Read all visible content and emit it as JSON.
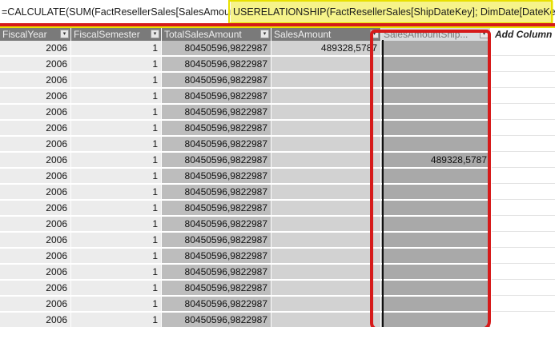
{
  "formula": {
    "part1": "=CALCULATE(SUM(FactResellerSales[SalesAmount]);",
    "part2": "USERELATIONSHIP(FactResellerSales[ShipDateKey]; DimDate[DateKey]))"
  },
  "headers": [
    "FiscalYear",
    "FiscalSemester",
    "TotalSalesAmount",
    "SalesAmount",
    "SalesAmountShip..."
  ],
  "add_column": "Add Column",
  "rows": [
    {
      "year": "2006",
      "semester": "1",
      "total": "80450596,9822987",
      "sales": "489328,5787",
      "ship": ""
    },
    {
      "year": "2006",
      "semester": "1",
      "total": "80450596,9822987",
      "sales": "",
      "ship": ""
    },
    {
      "year": "2006",
      "semester": "1",
      "total": "80450596,9822987",
      "sales": "",
      "ship": ""
    },
    {
      "year": "2006",
      "semester": "1",
      "total": "80450596,9822987",
      "sales": "",
      "ship": ""
    },
    {
      "year": "2006",
      "semester": "1",
      "total": "80450596,9822987",
      "sales": "",
      "ship": ""
    },
    {
      "year": "2006",
      "semester": "1",
      "total": "80450596,9822987",
      "sales": "",
      "ship": ""
    },
    {
      "year": "2006",
      "semester": "1",
      "total": "80450596,9822987",
      "sales": "",
      "ship": ""
    },
    {
      "year": "2006",
      "semester": "1",
      "total": "80450596,9822987",
      "sales": "",
      "ship": "489328,5787"
    },
    {
      "year": "2006",
      "semester": "1",
      "total": "80450596,9822987",
      "sales": "",
      "ship": ""
    },
    {
      "year": "2006",
      "semester": "1",
      "total": "80450596,9822987",
      "sales": "",
      "ship": ""
    },
    {
      "year": "2006",
      "semester": "1",
      "total": "80450596,9822987",
      "sales": "",
      "ship": ""
    },
    {
      "year": "2006",
      "semester": "1",
      "total": "80450596,9822987",
      "sales": "",
      "ship": ""
    },
    {
      "year": "2006",
      "semester": "1",
      "total": "80450596,9822987",
      "sales": "",
      "ship": ""
    },
    {
      "year": "2006",
      "semester": "1",
      "total": "80450596,9822987",
      "sales": "",
      "ship": ""
    },
    {
      "year": "2006",
      "semester": "1",
      "total": "80450596,9822987",
      "sales": "",
      "ship": ""
    },
    {
      "year": "2006",
      "semester": "1",
      "total": "80450596,9822987",
      "sales": "",
      "ship": ""
    },
    {
      "year": "2006",
      "semester": "1",
      "total": "80450596,9822987",
      "sales": "",
      "ship": ""
    },
    {
      "year": "2006",
      "semester": "1",
      "total": "80450596,9822987",
      "sales": "",
      "ship": ""
    }
  ],
  "colors": {
    "annotation_red": "#d61a1a",
    "highlight_yellow": "#f6f38a",
    "header_gray": "#7a7a7a"
  }
}
